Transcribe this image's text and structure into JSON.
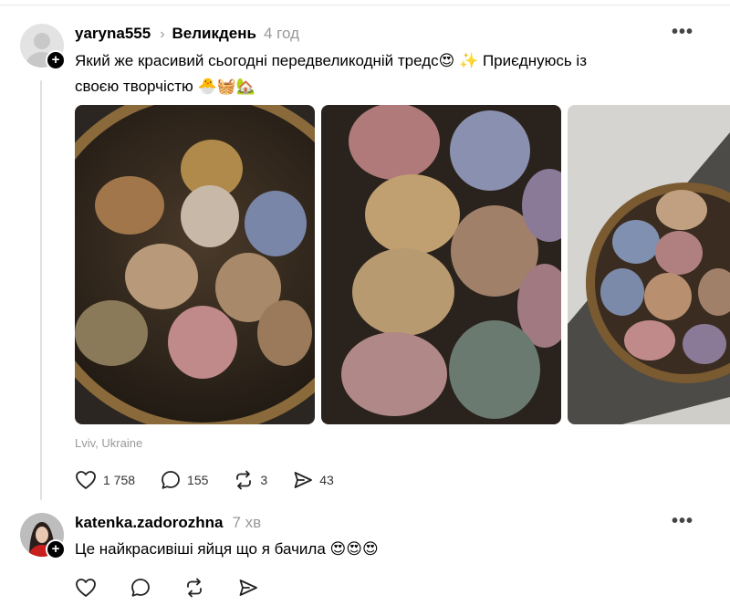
{
  "post": {
    "username": "yaryna555",
    "topic": "Великдень",
    "time": "4 год",
    "text_line1": "Який же красивий сьогодні передвеликодній тредс😍 ✨ Приєднуюсь із",
    "text_line2": "своєю творчістю 🐣🧺🏡",
    "location": "Lviv, Ukraine",
    "likes": "1 758",
    "comments": "155",
    "reposts": "3",
    "shares": "43"
  },
  "reply": {
    "username": "katenka.zadorozhna",
    "time": "7 хв",
    "text": "Це найкрасивіші яйця що я бачила 😍😍😍"
  },
  "icons": {
    "more": "more-horizontal-icon",
    "like": "heart-icon",
    "comment": "comment-bubble-icon",
    "repost": "repost-icon",
    "share": "send-icon",
    "follow": "plus-icon"
  },
  "colors": {
    "text": "#000000",
    "muted": "#999999",
    "icon": "#333333"
  }
}
